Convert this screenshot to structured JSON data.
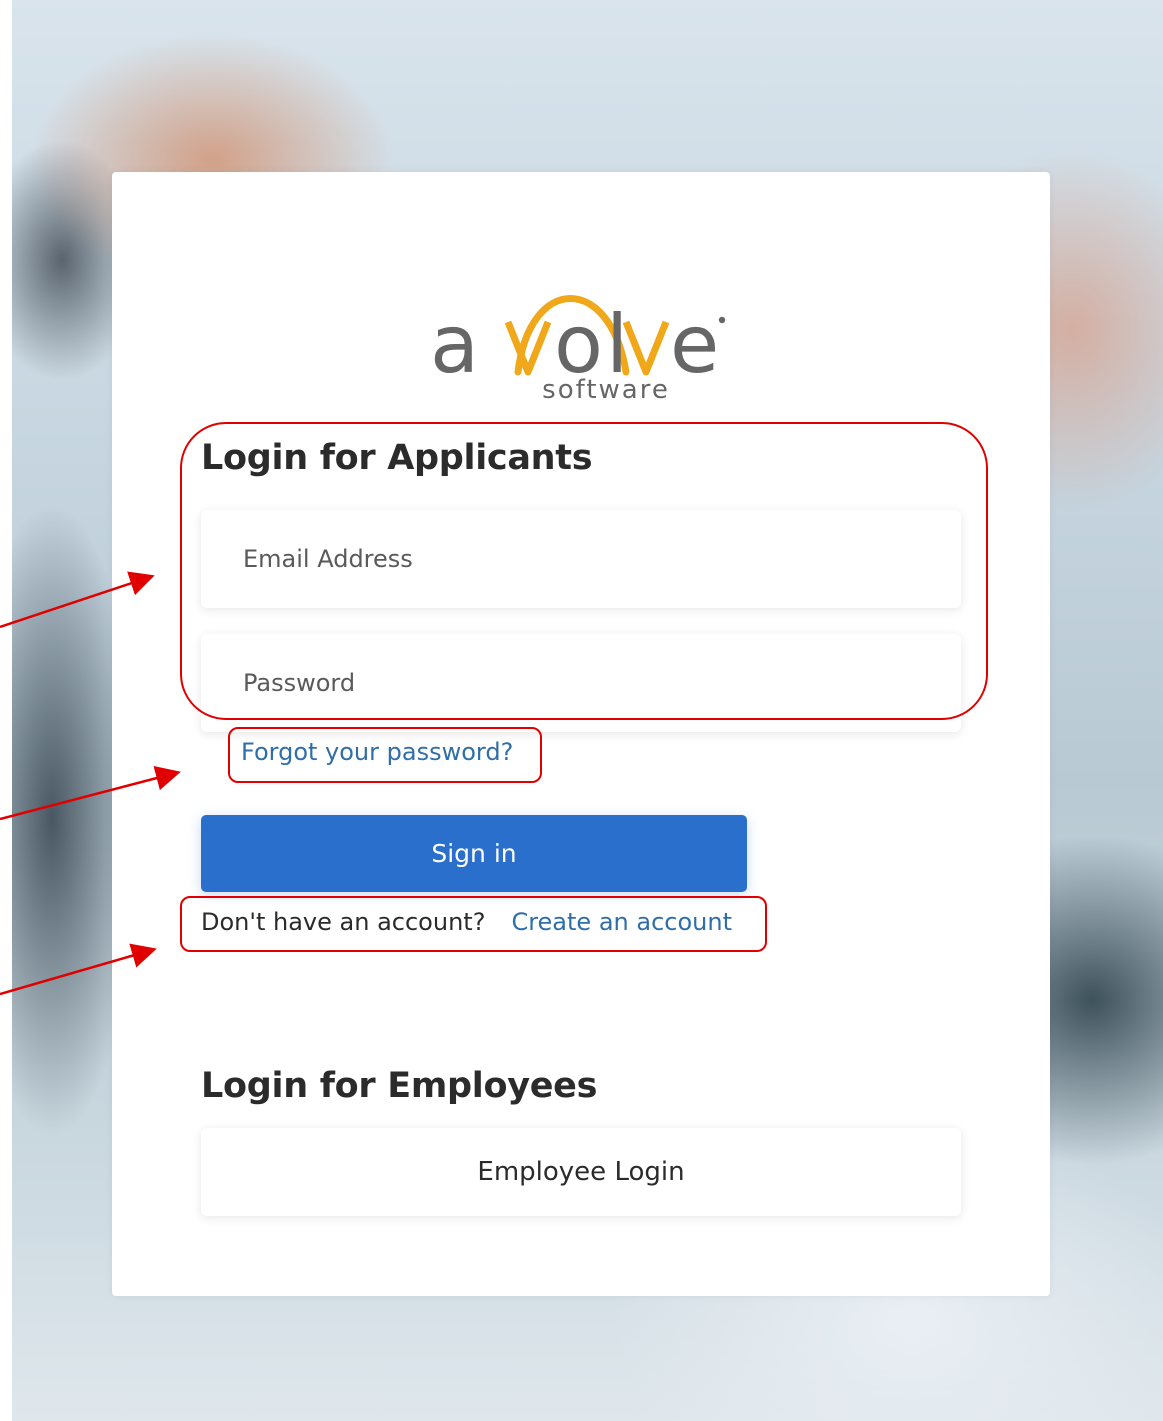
{
  "brand": {
    "logo_wordmark": "avolve",
    "logo_sub": "software"
  },
  "applicants": {
    "title": "Login for Applicants",
    "email_placeholder": "Email Address",
    "password_placeholder": "Password",
    "forgot_label": "Forgot your password?",
    "signin_label": "Sign in",
    "no_account_text": "Don't have an account?",
    "create_account_label": "Create an account"
  },
  "employees": {
    "title": "Login for Employees",
    "employee_login_label": "Employee Login"
  },
  "colors": {
    "primary_button": "#2a6fcb",
    "link": "#2f6ea8",
    "annotation": "#e00000",
    "logo_arc": "#f0a81a",
    "logo_text": "#666666"
  }
}
